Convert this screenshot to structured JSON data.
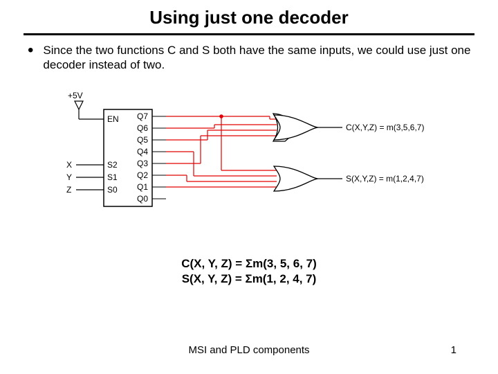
{
  "title": "Using just one decoder",
  "bullet": "Since the two functions C and S both have the same inputs, we could use just one decoder instead of two.",
  "diagram": {
    "vcc": "+5V",
    "en": "EN",
    "inputs": [
      "X",
      "Y",
      "Z"
    ],
    "select": [
      "S2",
      "S1",
      "S0"
    ],
    "outputs": [
      "Q7",
      "Q6",
      "Q5",
      "Q4",
      "Q3",
      "Q2",
      "Q1",
      "Q0"
    ],
    "gateC": "C(X,Y,Z) = m(3,5,6,7)",
    "gateS": "S(X,Y,Z) = m(1,2,4,7)"
  },
  "equations": {
    "lineC": "C(X, Y, Z) = Σm(3, 5, 6, 7)",
    "lineS": "S(X, Y, Z) = Σm(1, 2, 4, 7)"
  },
  "footer": {
    "center": "MSI and PLD components",
    "page": "1"
  }
}
